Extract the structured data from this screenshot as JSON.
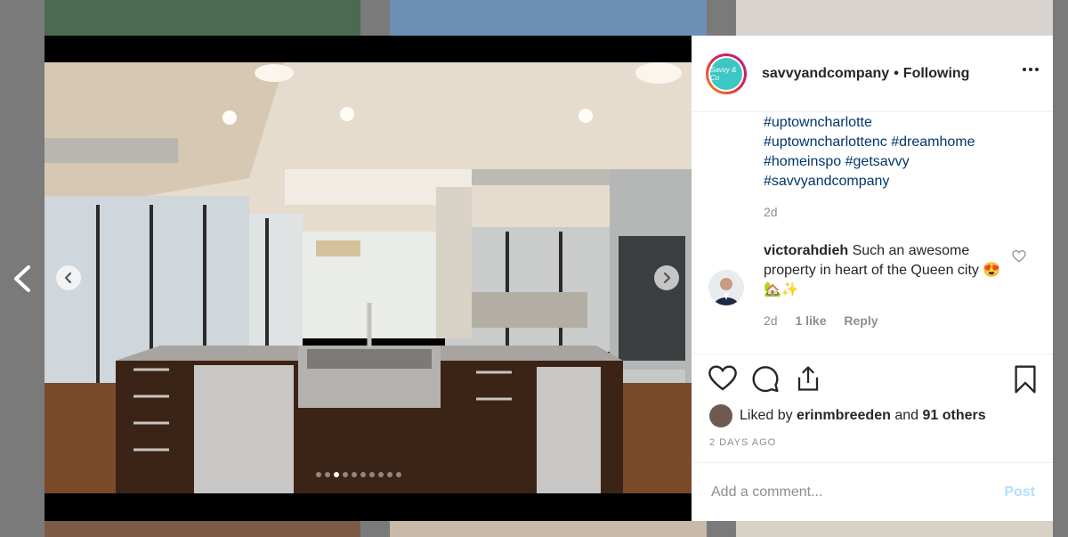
{
  "post": {
    "username": "savvyandcompany",
    "separator": "•",
    "following_label": "Following",
    "avatar_text": "Savvy & Co",
    "hashtags": [
      "#uptowncharlotte",
      "#uptowncharlottenc #dreamhome",
      "#homeinspo #getsavvy",
      "#savvyandcompany"
    ],
    "caption_time": "2d",
    "likes_prefix": "Liked by",
    "likes_user": "erinmbreeden",
    "likes_middle": "and",
    "likes_count": "91 others",
    "date": "2 DAYS AGO"
  },
  "comment": {
    "username": "victorahdieh",
    "text": "Such an awesome property in heart of the Queen city 😍🏡✨",
    "time": "2d",
    "likes": "1 like",
    "reply": "Reply"
  },
  "composer": {
    "placeholder": "Add a comment...",
    "post_label": "Post"
  },
  "carousel": {
    "total_slides": 10,
    "active_slide": 3
  },
  "icons": {
    "prev": "chevron-left-icon",
    "next": "chevron-right-icon",
    "like": "heart-icon",
    "comment": "comment-bubble-icon",
    "share": "share-icon",
    "save": "bookmark-icon",
    "more": "more-options-icon"
  },
  "colors": {
    "link": "#00376b",
    "muted": "#8e8e8e",
    "post_button": "#b2dffc",
    "brand_teal": "#3cc6c4"
  }
}
